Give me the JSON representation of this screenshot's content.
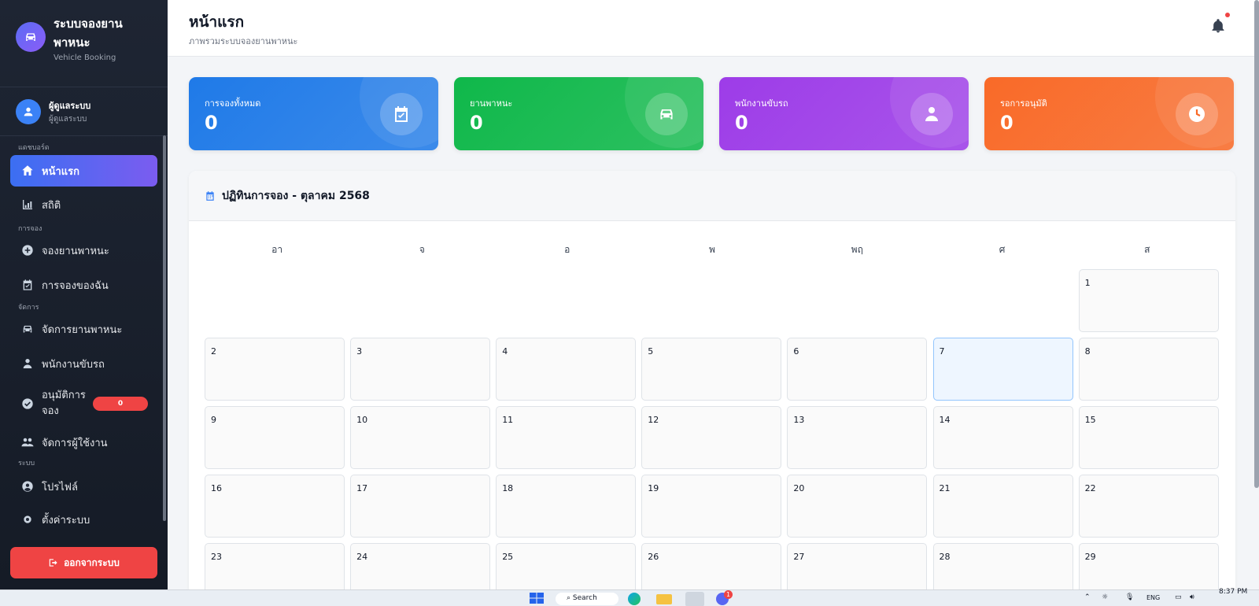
{
  "brand": {
    "title": "ระบบจองยานพาหนะ",
    "subtitle": "Vehicle Booking"
  },
  "user": {
    "name": "ผู้ดูแลระบบ",
    "role": "ผู้ดูแลระบบ"
  },
  "sections": {
    "dashboard": "แดชบอร์ด",
    "booking": "การจอง",
    "manage": "จัดการ",
    "system": "ระบบ"
  },
  "nav": {
    "home": "หน้าแรก",
    "stats": "สถิติ",
    "book_vehicle": "จองยานพาหนะ",
    "my_bookings": "การจองของฉัน",
    "manage_vehicles": "จัดการยานพาหนะ",
    "drivers": "พนักงานขับรถ",
    "approve_line1": "อนุมัติการ",
    "approve_line2": "จอง",
    "approve_badge": "0",
    "manage_users": "จัดการผู้ใช้งาน",
    "profile": "โปรไฟล์",
    "settings": "ตั้งค่าระบบ"
  },
  "logout": "ออกจากระบบ",
  "header": {
    "title": "หน้าแรก",
    "subtitle": "ภาพรวมระบบจองยานพาหนะ"
  },
  "stats": [
    {
      "label": "การจองทั้งหมด",
      "value": "0",
      "color": "#1f7ae8"
    },
    {
      "label": "ยานพาหนะ",
      "value": "0",
      "color": "#0fb84a"
    },
    {
      "label": "พนักงานขับรถ",
      "value": "0",
      "color": "#9d3ce8"
    },
    {
      "label": "รอการอนุมัติ",
      "value": "0",
      "color": "#f96a28"
    }
  ],
  "calendar": {
    "title": "ปฏิทินการจอง - ตุลาคม 2568",
    "weekdays": [
      "อา",
      "จ",
      "อ",
      "พ",
      "พฤ",
      "ศ",
      "ส"
    ],
    "first_weekday_index": 6,
    "visible_days": 29,
    "today": 7
  },
  "taskbar": {
    "search": "Search",
    "lang": "ENG",
    "time": "8:37 PM",
    "notif_count": "1"
  }
}
